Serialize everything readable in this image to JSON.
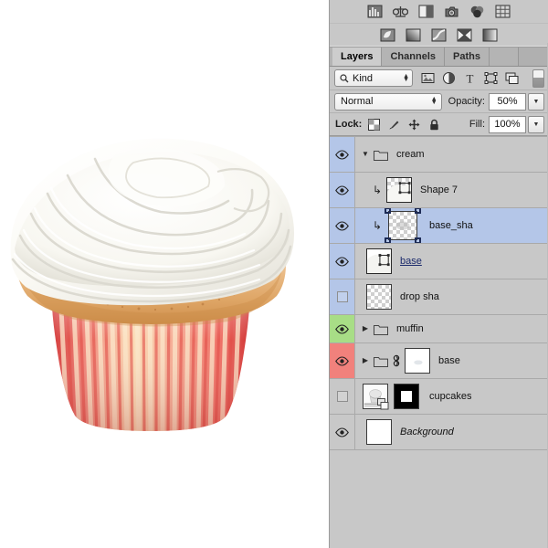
{
  "app": {
    "name": "Adobe Photoshop"
  },
  "canvas": {
    "artwork_name": "cupcake-illustration",
    "colors": {
      "frosting_light": "#fdfcf8",
      "frosting_shadow": "#d8d7d1",
      "cake_light": "#f3cfa0",
      "cake_dark": "#d79f61",
      "liner_red": "#e8403c",
      "liner_salmon": "#f2766a",
      "liner_cream": "#fbe6c8",
      "background": "#ffffff"
    }
  },
  "toolbar_strips": {
    "row1": [
      {
        "name": "histogram-icon",
        "title": "Histogram"
      },
      {
        "name": "balance-scale-icon",
        "title": "Info"
      },
      {
        "name": "halves-square-icon",
        "title": "Properties"
      },
      {
        "name": "camera-icon",
        "title": "Camera Raw"
      },
      {
        "name": "color-wheels-icon",
        "title": "Color"
      },
      {
        "name": "grid-icon",
        "title": "Swatches"
      }
    ],
    "row2": [
      {
        "name": "brightness-contrast-icon",
        "title": "Brightness/Contrast"
      },
      {
        "name": "levels-icon",
        "title": "Levels"
      },
      {
        "name": "curves-icon",
        "title": "Curves"
      },
      {
        "name": "exposure-icon",
        "title": "Exposure"
      },
      {
        "name": "gradient-map-icon",
        "title": "Gradient Map"
      }
    ]
  },
  "tabs": [
    {
      "label": "Layers",
      "active": true
    },
    {
      "label": "Channels",
      "active": false
    },
    {
      "label": "Paths",
      "active": false
    }
  ],
  "filter_row": {
    "kind_label": "Kind",
    "search_icon": "magnifier-icon",
    "filter_icons": [
      {
        "name": "filter-pixel-icon",
        "title": "Pixel layers"
      },
      {
        "name": "filter-adjustment-icon",
        "title": "Adjustment layers"
      },
      {
        "name": "filter-type-icon",
        "title": "Type layers"
      },
      {
        "name": "filter-shape-icon",
        "title": "Shape layers"
      },
      {
        "name": "filter-smartobject-icon",
        "title": "Smart objects"
      }
    ],
    "toggle_name": "filter-enable-toggle"
  },
  "blend_row": {
    "blend_mode": "Normal",
    "opacity_label": "Opacity:",
    "opacity_value": "50%"
  },
  "lock_row": {
    "lock_label": "Lock:",
    "lock_icons": [
      {
        "name": "lock-transparent-pixels-icon"
      },
      {
        "name": "lock-image-pixels-icon"
      },
      {
        "name": "lock-position-icon"
      },
      {
        "name": "lock-all-icon"
      }
    ],
    "fill_label": "Fill:",
    "fill_value": "100%"
  },
  "layers": [
    {
      "name": "cream",
      "type": "group",
      "visible": true,
      "eye_color": "#b4c6e8",
      "selected": false,
      "expanded": true,
      "disclosure": "▼",
      "has_folder": true,
      "indent": 0,
      "clipped": false,
      "thumb": "none"
    },
    {
      "name": "Shape 7",
      "type": "shape",
      "visible": true,
      "eye_color": "#b4c6e8",
      "selected": false,
      "has_folder": false,
      "indent": 1,
      "clipped": true,
      "thumb": "vector"
    },
    {
      "name": "base_sha",
      "type": "pixel",
      "visible": true,
      "eye_color": "#b4c6e8",
      "selected": true,
      "has_folder": false,
      "indent": 1,
      "clipped": true,
      "thumb": "transparent-big"
    },
    {
      "name": "base",
      "type": "shape",
      "visible": true,
      "eye_color": "#b4c6e8",
      "selected": false,
      "has_folder": false,
      "indent": 0,
      "clipped": false,
      "thumb": "vector",
      "name_style": "link"
    },
    {
      "name": "drop sha",
      "type": "pixel",
      "visible": false,
      "eye_color": "#b4c6e8",
      "selected": false,
      "has_folder": false,
      "indent": 0,
      "clipped": false,
      "thumb": "transparent"
    },
    {
      "name": "muffin",
      "type": "group",
      "visible": true,
      "eye_color": "#a8dd86",
      "selected": false,
      "expanded": false,
      "disclosure": "▶",
      "has_folder": true,
      "indent": 0,
      "clipped": false,
      "thumb": "none"
    },
    {
      "name": "base",
      "type": "group",
      "visible": true,
      "eye_color": "#f1817c",
      "selected": false,
      "expanded": false,
      "disclosure": "▶",
      "has_folder": true,
      "linked": true,
      "indent": 0,
      "clipped": false,
      "thumb": "white-blob"
    },
    {
      "name": "cupcakes",
      "type": "smart-object",
      "visible": false,
      "eye_color": "#c8c8c8",
      "selected": false,
      "has_folder": false,
      "indent": 0,
      "clipped": false,
      "thumb": "smart-object",
      "has_mask": true
    },
    {
      "name": "Background",
      "type": "background",
      "visible": true,
      "eye_color": "#c8c8c8",
      "selected": false,
      "has_folder": false,
      "indent": 0,
      "clipped": false,
      "thumb": "white",
      "name_style": "italic"
    }
  ]
}
